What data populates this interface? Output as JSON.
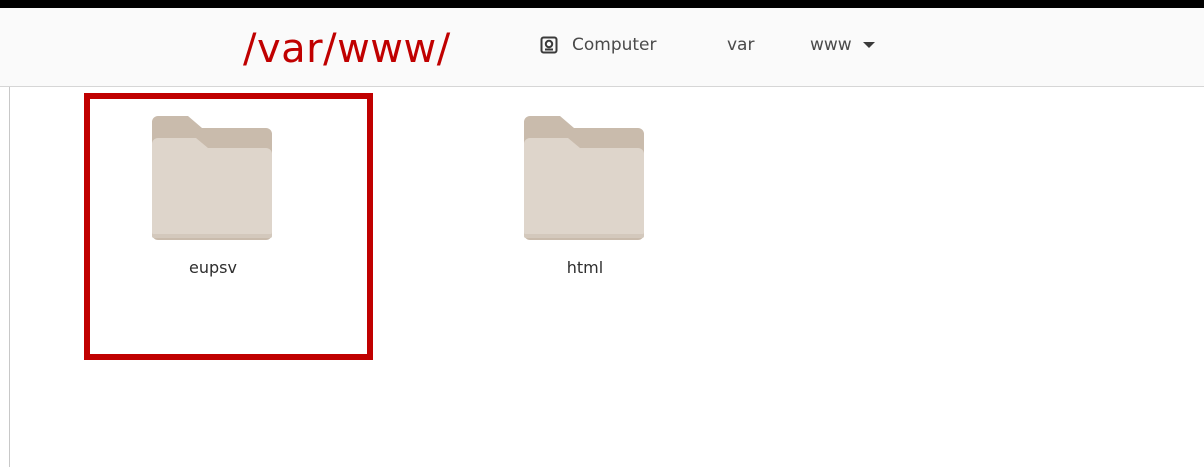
{
  "annotation": {
    "path_label": "/var/www/",
    "color": "#c00000"
  },
  "breadcrumb": {
    "items": [
      {
        "label": "Computer",
        "icon": "drive-icon"
      },
      {
        "label": "var"
      },
      {
        "label": "www",
        "icon": "chevron-down-icon"
      }
    ]
  },
  "folders": [
    {
      "name": "eupsv",
      "icon": "folder-icon",
      "highlighted": true
    },
    {
      "name": "html",
      "icon": "folder-icon",
      "highlighted": false
    }
  ],
  "colors": {
    "folder_back": "#c9bbac",
    "folder_front": "#ded5cb",
    "highlight": "#c00000"
  }
}
